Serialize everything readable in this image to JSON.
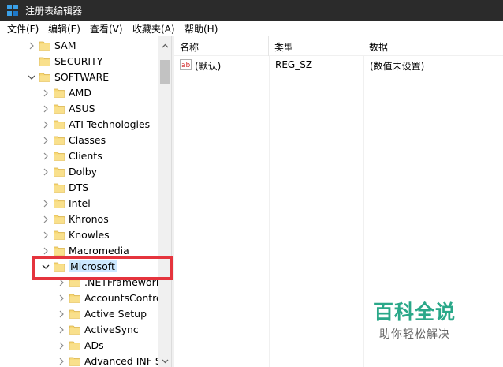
{
  "window": {
    "title": "注册表编辑器",
    "icon": "regedit-icon"
  },
  "menu": [
    "文件(F)",
    "编辑(E)",
    "查看(V)",
    "收藏夹(A)",
    "帮助(H)"
  ],
  "tree": [
    {
      "label": "SAM",
      "level": 1,
      "expander": "collapsed",
      "selected": false
    },
    {
      "label": "SECURITY",
      "level": 1,
      "expander": "none",
      "selected": false
    },
    {
      "label": "SOFTWARE",
      "level": 1,
      "expander": "expanded",
      "selected": false
    },
    {
      "label": "AMD",
      "level": 2,
      "expander": "collapsed",
      "selected": false
    },
    {
      "label": "ASUS",
      "level": 2,
      "expander": "collapsed",
      "selected": false
    },
    {
      "label": "ATI Technologies",
      "level": 2,
      "expander": "collapsed",
      "selected": false
    },
    {
      "label": "Classes",
      "level": 2,
      "expander": "collapsed",
      "selected": false
    },
    {
      "label": "Clients",
      "level": 2,
      "expander": "collapsed",
      "selected": false
    },
    {
      "label": "Dolby",
      "level": 2,
      "expander": "collapsed",
      "selected": false
    },
    {
      "label": "DTS",
      "level": 2,
      "expander": "none",
      "selected": false
    },
    {
      "label": "Intel",
      "level": 2,
      "expander": "collapsed",
      "selected": false
    },
    {
      "label": "Khronos",
      "level": 2,
      "expander": "collapsed",
      "selected": false
    },
    {
      "label": "Knowles",
      "level": 2,
      "expander": "collapsed",
      "selected": false
    },
    {
      "label": "Macromedia",
      "level": 2,
      "expander": "collapsed",
      "selected": false
    },
    {
      "label": "Microsoft",
      "level": 2,
      "expander": "expanded",
      "selected": true
    },
    {
      "label": ".NETFramework",
      "level": 3,
      "expander": "collapsed",
      "selected": false
    },
    {
      "label": "AccountsControl",
      "level": 3,
      "expander": "collapsed",
      "selected": false
    },
    {
      "label": "Active Setup",
      "level": 3,
      "expander": "collapsed",
      "selected": false
    },
    {
      "label": "ActiveSync",
      "level": 3,
      "expander": "collapsed",
      "selected": false
    },
    {
      "label": "ADs",
      "level": 3,
      "expander": "collapsed",
      "selected": false
    },
    {
      "label": "Advanced INF Setup",
      "level": 3,
      "expander": "collapsed",
      "selected": false
    }
  ],
  "list": {
    "columns": [
      "名称",
      "类型",
      "数据"
    ],
    "rows": [
      {
        "name": "(默认)",
        "type": "REG_SZ",
        "data": "(数值未设置)",
        "icon": "string-value-icon"
      }
    ]
  },
  "watermark": {
    "title": "百科全说",
    "subtitle": "助你轻松解决"
  },
  "colors": {
    "titlebar": "#2b2b2b",
    "selection": "#cce8ff",
    "highlight": "#e5343d",
    "folder": "#f7d774",
    "watermark": "#2aa889"
  }
}
